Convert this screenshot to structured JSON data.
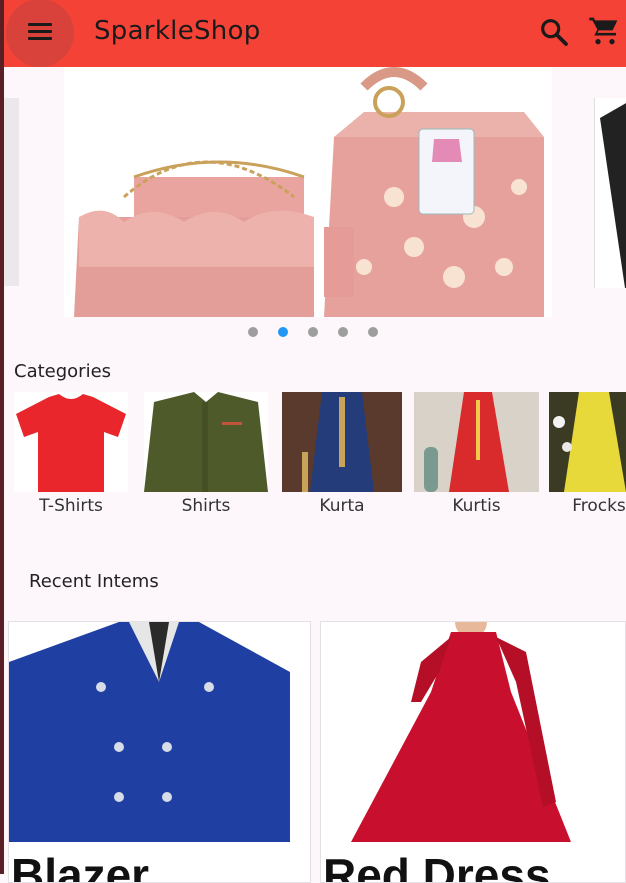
{
  "app_bar": {
    "title": "SparkleShop",
    "icons": [
      "menu-icon",
      "search-icon",
      "shopping-cart-icon"
    ],
    "color": "#f44336"
  },
  "carousel": {
    "dot_count": 5,
    "active_dot_index": 1
  },
  "categories": {
    "title": "Categories",
    "items": [
      {
        "label": "T-Shirts"
      },
      {
        "label": "Shirts"
      },
      {
        "label": "Kurta"
      },
      {
        "label": "Kurtis"
      },
      {
        "label": "Frocks"
      }
    ]
  },
  "recent": {
    "title": "Recent Intems",
    "items": [
      {
        "name": "Blazer"
      },
      {
        "name": "Red Dress"
      }
    ]
  }
}
